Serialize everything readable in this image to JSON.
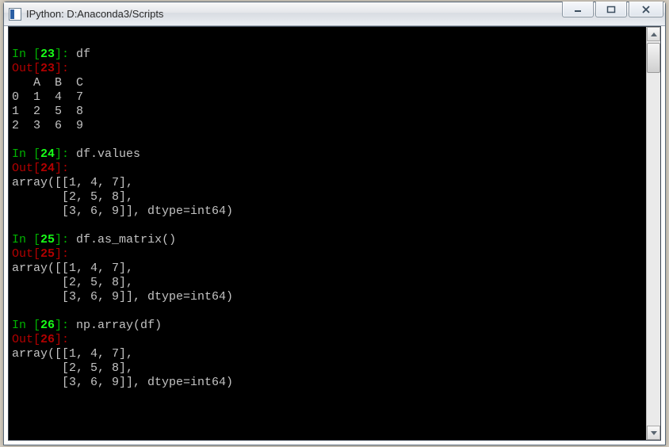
{
  "window": {
    "title": "IPython: D:Anaconda3/Scripts"
  },
  "cells": [
    {
      "n": "23",
      "input": "df",
      "output": [
        "   A  B  C",
        "0  1  4  7",
        "1  2  5  8",
        "2  3  6  9"
      ]
    },
    {
      "n": "24",
      "input": "df.values",
      "output": [
        "array([[1, 4, 7],",
        "       [2, 5, 8],",
        "       [3, 6, 9]], dtype=int64)"
      ]
    },
    {
      "n": "25",
      "input": "df.as_matrix()",
      "output": [
        "array([[1, 4, 7],",
        "       [2, 5, 8],",
        "       [3, 6, 9]], dtype=int64)"
      ]
    },
    {
      "n": "26",
      "input": "np.array(df)",
      "output": [
        "array([[1, 4, 7],",
        "       [2, 5, 8],",
        "       [3, 6, 9]], dtype=int64)"
      ]
    }
  ],
  "chart_data": {
    "type": "table",
    "title": "DataFrame df",
    "columns": [
      "A",
      "B",
      "C"
    ],
    "index": [
      0,
      1,
      2
    ],
    "values": [
      [
        1,
        4,
        7
      ],
      [
        2,
        5,
        8
      ],
      [
        3,
        6,
        9
      ]
    ],
    "dtype": "int64"
  }
}
